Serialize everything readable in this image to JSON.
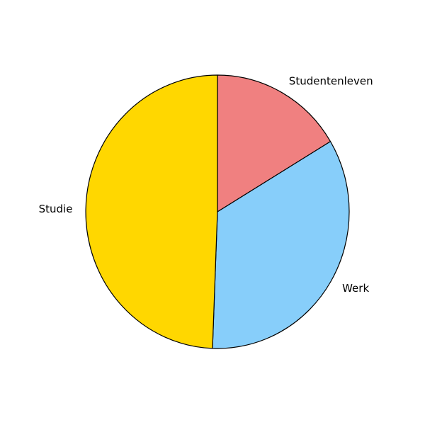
{
  "chart_data": {
    "type": "pie",
    "title": "",
    "categories": [
      "Studentenleven",
      "Werk",
      "Studie"
    ],
    "values": [
      16.4,
      34.2,
      49.4
    ],
    "colors": [
      "#f08080",
      "#87cefa",
      "#ffd700"
    ],
    "start_angle_deg": 90,
    "direction": "clockwise",
    "edge_color": "#000000",
    "legend": "none"
  }
}
